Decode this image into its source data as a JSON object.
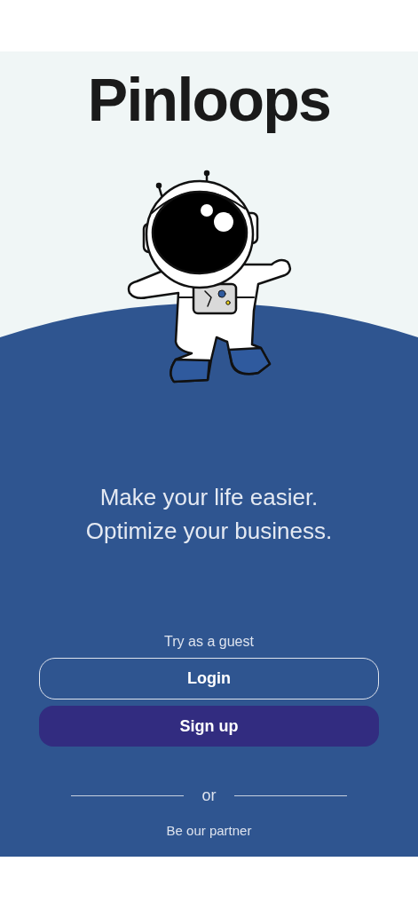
{
  "title": "Pinloops",
  "tagline": "Make your life easier.\nOptimize your business.",
  "guest_link": "Try as a guest",
  "buttons": [
    {
      "label": "Login",
      "kind": "outline"
    },
    {
      "label": "Sign up",
      "kind": "filled"
    }
  ],
  "divider_text": "or",
  "partner_link": "Be our partner"
}
